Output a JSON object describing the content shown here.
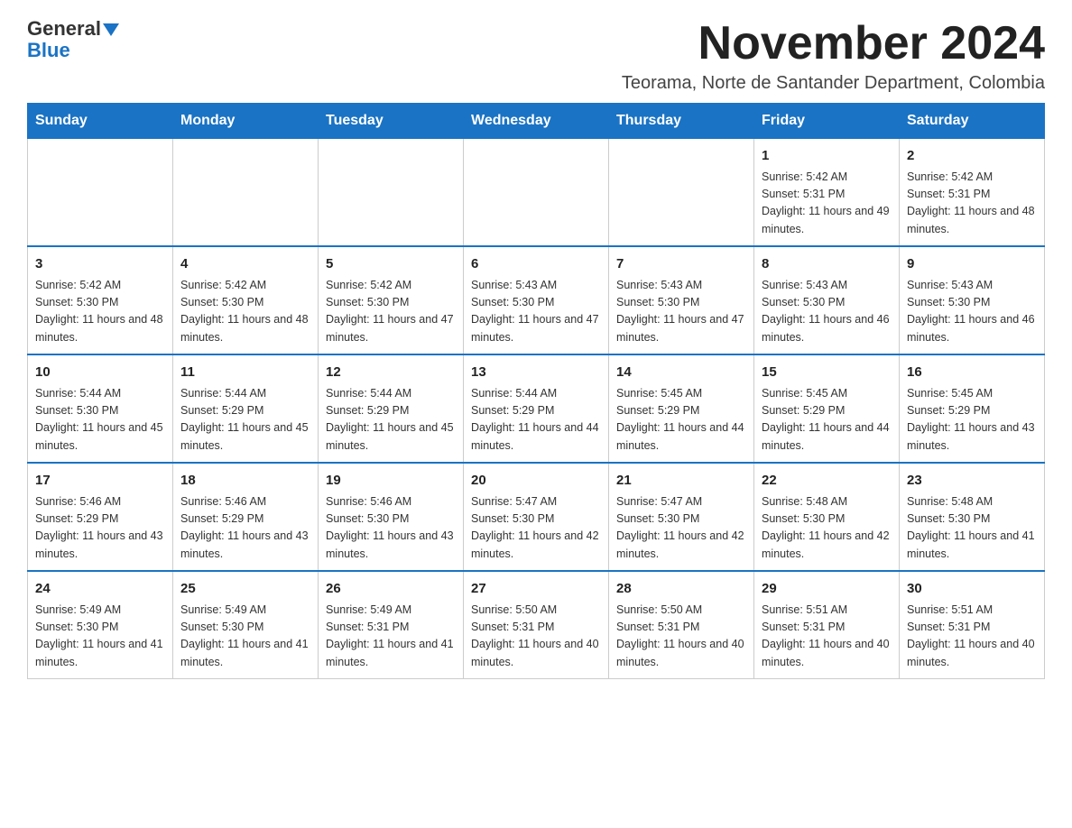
{
  "header": {
    "logo_line1": "General",
    "logo_line2": "Blue",
    "month_title": "November 2024",
    "location": "Teorama, Norte de Santander Department, Colombia"
  },
  "days_of_week": [
    "Sunday",
    "Monday",
    "Tuesday",
    "Wednesday",
    "Thursday",
    "Friday",
    "Saturday"
  ],
  "weeks": [
    [
      {
        "day": "",
        "info": ""
      },
      {
        "day": "",
        "info": ""
      },
      {
        "day": "",
        "info": ""
      },
      {
        "day": "",
        "info": ""
      },
      {
        "day": "",
        "info": ""
      },
      {
        "day": "1",
        "info": "Sunrise: 5:42 AM\nSunset: 5:31 PM\nDaylight: 11 hours and 49 minutes."
      },
      {
        "day": "2",
        "info": "Sunrise: 5:42 AM\nSunset: 5:31 PM\nDaylight: 11 hours and 48 minutes."
      }
    ],
    [
      {
        "day": "3",
        "info": "Sunrise: 5:42 AM\nSunset: 5:30 PM\nDaylight: 11 hours and 48 minutes."
      },
      {
        "day": "4",
        "info": "Sunrise: 5:42 AM\nSunset: 5:30 PM\nDaylight: 11 hours and 48 minutes."
      },
      {
        "day": "5",
        "info": "Sunrise: 5:42 AM\nSunset: 5:30 PM\nDaylight: 11 hours and 47 minutes."
      },
      {
        "day": "6",
        "info": "Sunrise: 5:43 AM\nSunset: 5:30 PM\nDaylight: 11 hours and 47 minutes."
      },
      {
        "day": "7",
        "info": "Sunrise: 5:43 AM\nSunset: 5:30 PM\nDaylight: 11 hours and 47 minutes."
      },
      {
        "day": "8",
        "info": "Sunrise: 5:43 AM\nSunset: 5:30 PM\nDaylight: 11 hours and 46 minutes."
      },
      {
        "day": "9",
        "info": "Sunrise: 5:43 AM\nSunset: 5:30 PM\nDaylight: 11 hours and 46 minutes."
      }
    ],
    [
      {
        "day": "10",
        "info": "Sunrise: 5:44 AM\nSunset: 5:30 PM\nDaylight: 11 hours and 45 minutes."
      },
      {
        "day": "11",
        "info": "Sunrise: 5:44 AM\nSunset: 5:29 PM\nDaylight: 11 hours and 45 minutes."
      },
      {
        "day": "12",
        "info": "Sunrise: 5:44 AM\nSunset: 5:29 PM\nDaylight: 11 hours and 45 minutes."
      },
      {
        "day": "13",
        "info": "Sunrise: 5:44 AM\nSunset: 5:29 PM\nDaylight: 11 hours and 44 minutes."
      },
      {
        "day": "14",
        "info": "Sunrise: 5:45 AM\nSunset: 5:29 PM\nDaylight: 11 hours and 44 minutes."
      },
      {
        "day": "15",
        "info": "Sunrise: 5:45 AM\nSunset: 5:29 PM\nDaylight: 11 hours and 44 minutes."
      },
      {
        "day": "16",
        "info": "Sunrise: 5:45 AM\nSunset: 5:29 PM\nDaylight: 11 hours and 43 minutes."
      }
    ],
    [
      {
        "day": "17",
        "info": "Sunrise: 5:46 AM\nSunset: 5:29 PM\nDaylight: 11 hours and 43 minutes."
      },
      {
        "day": "18",
        "info": "Sunrise: 5:46 AM\nSunset: 5:29 PM\nDaylight: 11 hours and 43 minutes."
      },
      {
        "day": "19",
        "info": "Sunrise: 5:46 AM\nSunset: 5:30 PM\nDaylight: 11 hours and 43 minutes."
      },
      {
        "day": "20",
        "info": "Sunrise: 5:47 AM\nSunset: 5:30 PM\nDaylight: 11 hours and 42 minutes."
      },
      {
        "day": "21",
        "info": "Sunrise: 5:47 AM\nSunset: 5:30 PM\nDaylight: 11 hours and 42 minutes."
      },
      {
        "day": "22",
        "info": "Sunrise: 5:48 AM\nSunset: 5:30 PM\nDaylight: 11 hours and 42 minutes."
      },
      {
        "day": "23",
        "info": "Sunrise: 5:48 AM\nSunset: 5:30 PM\nDaylight: 11 hours and 41 minutes."
      }
    ],
    [
      {
        "day": "24",
        "info": "Sunrise: 5:49 AM\nSunset: 5:30 PM\nDaylight: 11 hours and 41 minutes."
      },
      {
        "day": "25",
        "info": "Sunrise: 5:49 AM\nSunset: 5:30 PM\nDaylight: 11 hours and 41 minutes."
      },
      {
        "day": "26",
        "info": "Sunrise: 5:49 AM\nSunset: 5:31 PM\nDaylight: 11 hours and 41 minutes."
      },
      {
        "day": "27",
        "info": "Sunrise: 5:50 AM\nSunset: 5:31 PM\nDaylight: 11 hours and 40 minutes."
      },
      {
        "day": "28",
        "info": "Sunrise: 5:50 AM\nSunset: 5:31 PM\nDaylight: 11 hours and 40 minutes."
      },
      {
        "day": "29",
        "info": "Sunrise: 5:51 AM\nSunset: 5:31 PM\nDaylight: 11 hours and 40 minutes."
      },
      {
        "day": "30",
        "info": "Sunrise: 5:51 AM\nSunset: 5:31 PM\nDaylight: 11 hours and 40 minutes."
      }
    ]
  ]
}
